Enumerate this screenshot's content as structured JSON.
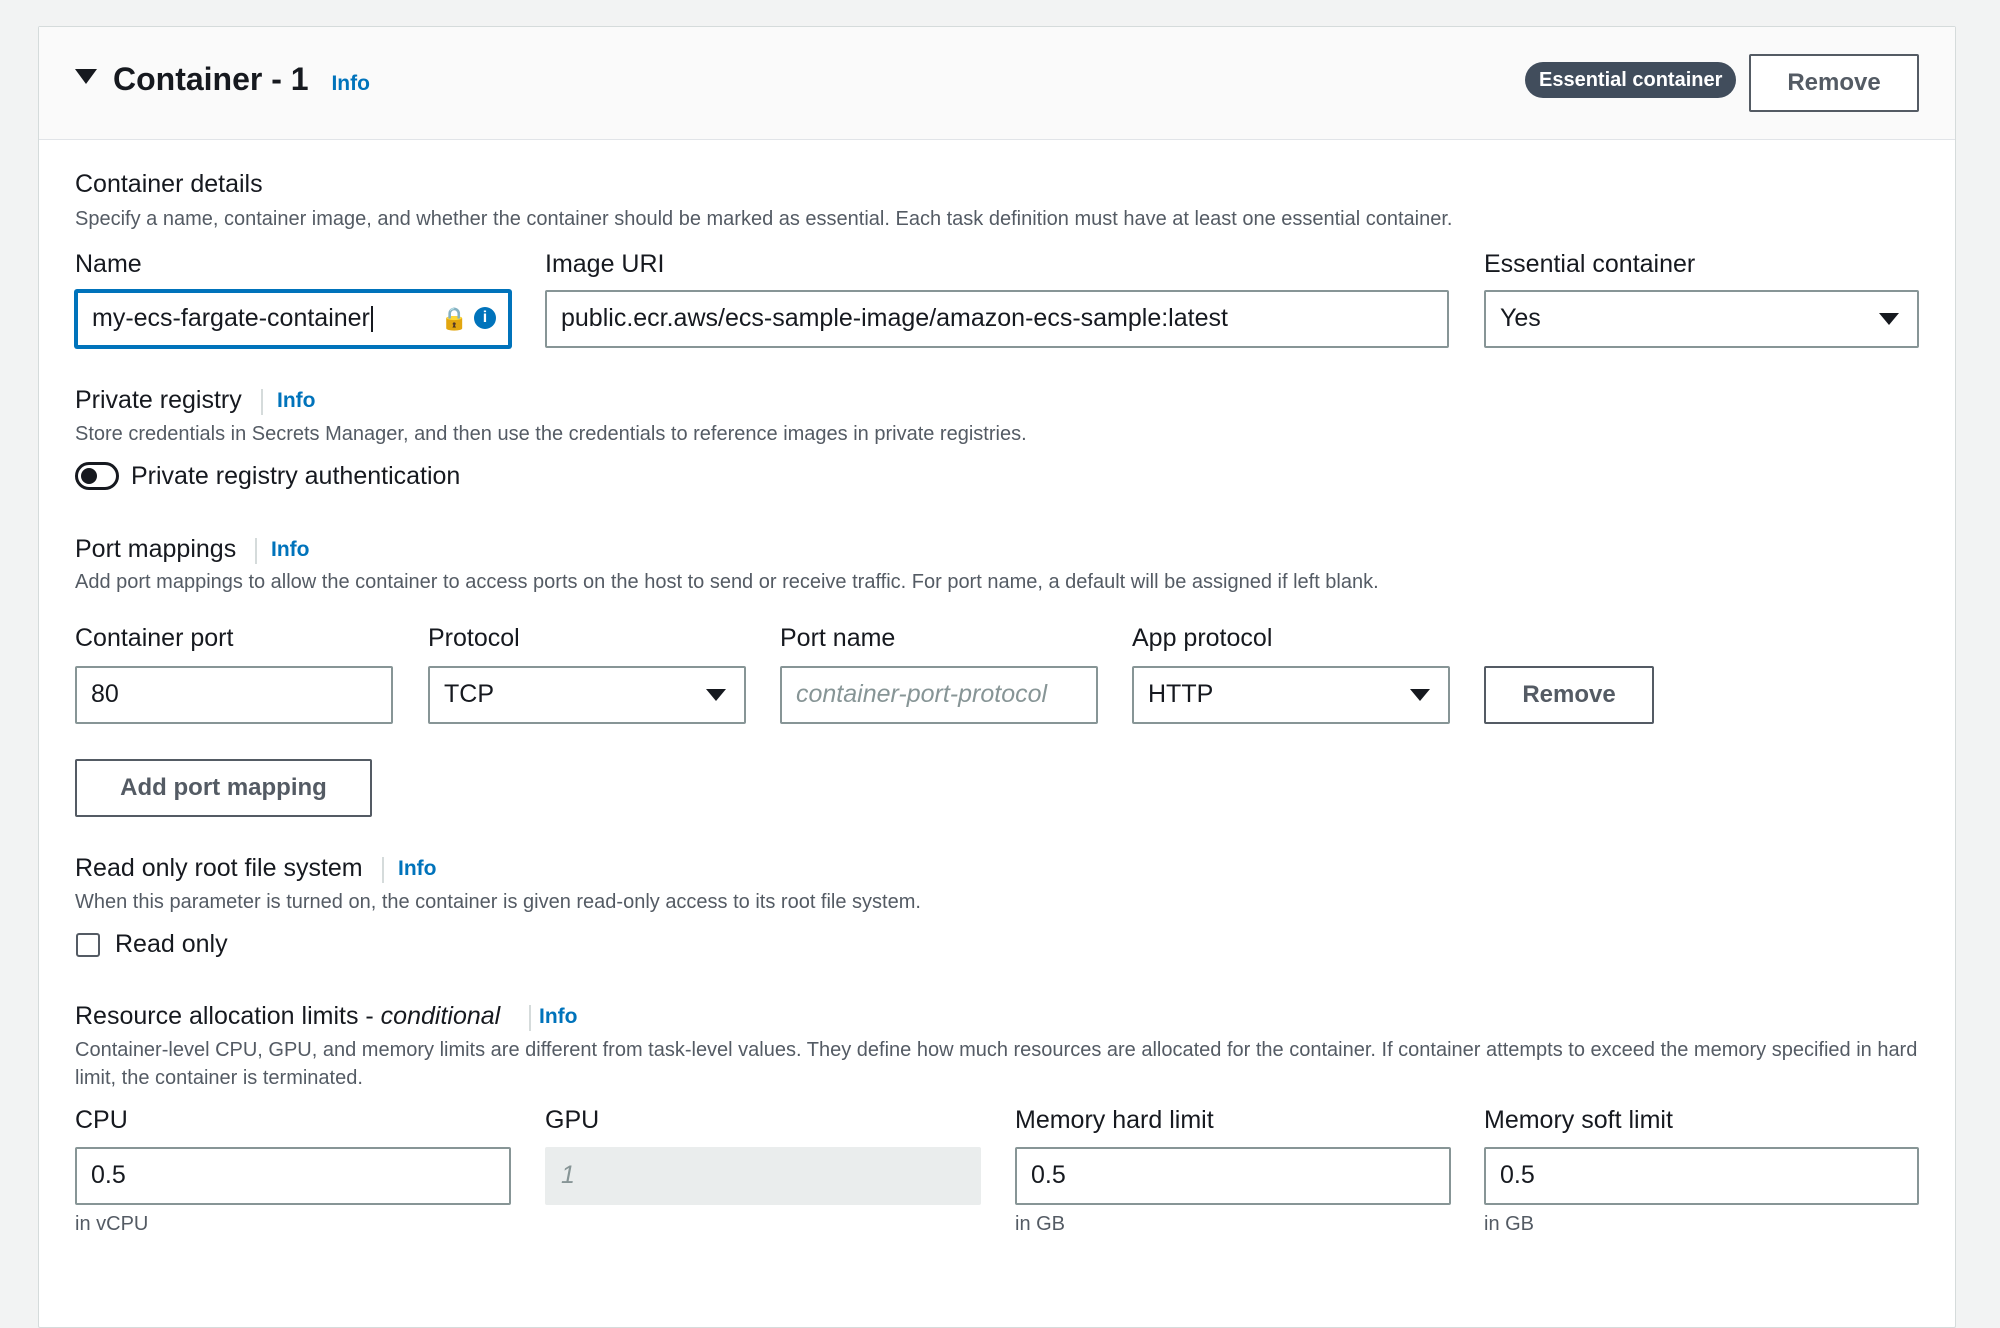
{
  "header": {
    "title": "Container - 1",
    "info": "Info",
    "badge": "Essential container",
    "remove_label": "Remove"
  },
  "container_details": {
    "heading": "Container details",
    "description": "Specify a name, container image, and whether the container should be marked as essential. Each task definition must have at least one essential container.",
    "name_label": "Name",
    "name_value": "my-ecs-fargate-container",
    "image_label": "Image URI",
    "image_value": "public.ecr.aws/ecs-sample-image/amazon-ecs-sample:latest",
    "essential_label": "Essential container",
    "essential_value": "Yes"
  },
  "private_registry": {
    "heading": "Private registry",
    "info": "Info",
    "description": "Store credentials in Secrets Manager, and then use the credentials to reference images in private registries.",
    "toggle_label": "Private registry authentication",
    "toggle_on": false
  },
  "port_mappings": {
    "heading": "Port mappings",
    "info": "Info",
    "description": "Add port mappings to allow the container to access ports on the host to send or receive traffic. For port name, a default will be assigned if left blank.",
    "container_port_label": "Container port",
    "container_port_value": "80",
    "protocol_label": "Protocol",
    "protocol_value": "TCP",
    "port_name_label": "Port name",
    "port_name_placeholder": "container-port-protocol",
    "app_protocol_label": "App protocol",
    "app_protocol_value": "HTTP",
    "remove_label": "Remove",
    "add_label": "Add port mapping"
  },
  "read_only": {
    "heading": "Read only root file system",
    "info": "Info",
    "description": "When this parameter is turned on, the container is given read-only access to its root file system.",
    "checkbox_label": "Read only",
    "checked": false
  },
  "resources": {
    "heading": "Resource allocation limits - ",
    "heading_em": "conditional",
    "info": "Info",
    "description": "Container-level CPU, GPU, and memory limits are different from task-level values. They define how much resources are allocated for the container. If container attempts to exceed the memory specified in hard limit, the container is terminated.",
    "cpu_label": "CPU",
    "cpu_value": "0.5",
    "cpu_hint": "in vCPU",
    "gpu_label": "GPU",
    "gpu_placeholder": "1",
    "mem_hard_label": "Memory hard limit",
    "mem_hard_value": "0.5",
    "mem_hard_hint": "in GB",
    "mem_soft_label": "Memory soft limit",
    "mem_soft_value": "0.5",
    "mem_soft_hint": "in GB"
  },
  "colors": {
    "link": "#0073bb",
    "badge_bg": "#414d5c",
    "focus_border": "#0073bb"
  }
}
